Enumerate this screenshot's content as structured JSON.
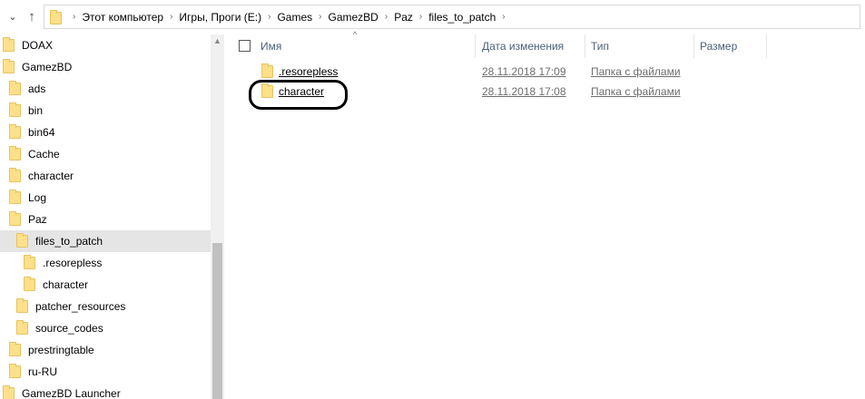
{
  "address_bar": {
    "back_icon": "chevron-down-icon",
    "up_icon": "up-arrow-icon",
    "crumbs": [
      "Этот компьютер",
      "Игры, Проги (E:)",
      "Games",
      "GamezBD",
      "Paz",
      "files_to_patch"
    ]
  },
  "nav_pane": {
    "items": [
      {
        "label": "DOAX"
      },
      {
        "label": "GamezBD"
      },
      {
        "label": "ads"
      },
      {
        "label": "bin"
      },
      {
        "label": "bin64"
      },
      {
        "label": "Cache"
      },
      {
        "label": "character"
      },
      {
        "label": "Log"
      },
      {
        "label": "Paz"
      },
      {
        "label": "files_to_patch",
        "selected": true
      },
      {
        "label": ".resorepless"
      },
      {
        "label": "character"
      },
      {
        "label": "patcher_resources"
      },
      {
        "label": "source_codes"
      },
      {
        "label": "prestringtable"
      },
      {
        "label": "ru-RU"
      },
      {
        "label": "GamezBD Launcher"
      }
    ]
  },
  "columns": {
    "name": "Имя",
    "date": "Дата изменения",
    "type": "Тип",
    "size": "Размер"
  },
  "files": [
    {
      "name": ".resorepless",
      "date": "28.11.2018 17:09",
      "type": "Папка с файлами"
    },
    {
      "name": "character",
      "date": "28.11.2018 17:08",
      "type": "Папка с файлами"
    }
  ],
  "colors": {
    "header_text": "#4c607a",
    "selection": "#e5e5e5",
    "folder": "#ffe08a"
  }
}
